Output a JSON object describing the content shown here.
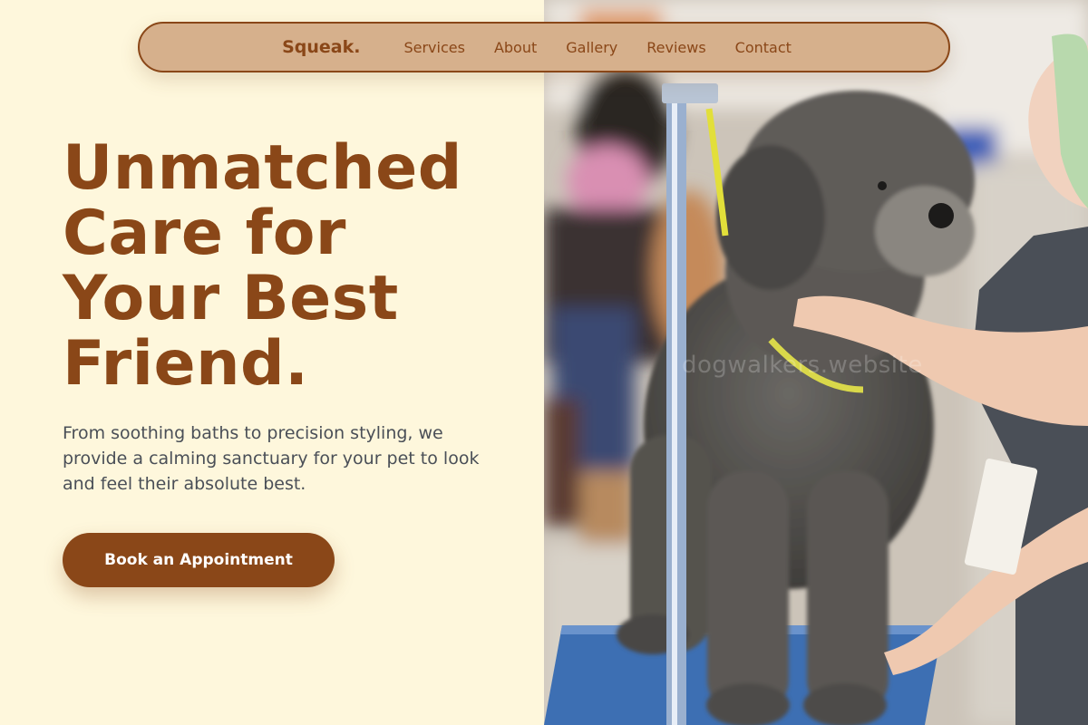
{
  "nav": {
    "brand": "Squeak.",
    "links": [
      "Services",
      "About",
      "Gallery",
      "Reviews",
      "Contact"
    ]
  },
  "hero": {
    "title_lines": [
      "Unmatched",
      "Care for",
      "Your Best",
      "Friend."
    ],
    "subtitle": "From soothing baths to precision styling, we provide a calming sanctuary for your pet to look and feel their absolute best.",
    "cta_label": "Book an Appointment"
  },
  "photo": {
    "watermark": "dogwalkers.website"
  },
  "colors": {
    "brand_brown": "#8a4718",
    "nav_background": "#d6b08c",
    "page_background": "#fef7dc",
    "body_text": "#4a4f57"
  }
}
